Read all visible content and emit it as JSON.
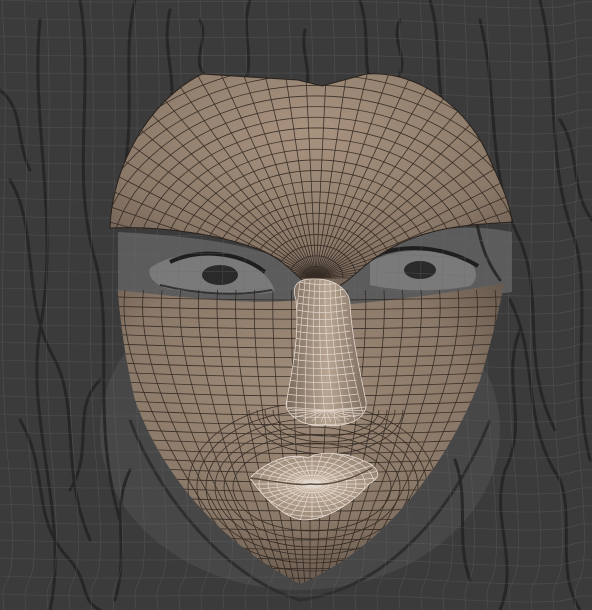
{
  "scene": {
    "description_tag": "3d-viewport",
    "colors": {
      "background": "#3b3b3b",
      "reference_sketch": "#242424",
      "reference_photo_tint": "#5a5a5a",
      "mesh_fill": "#8a7868",
      "mesh_fill_light": "#a08c7a",
      "mesh_fill_shadow": "#5e5046",
      "wire_dark": "#2a221c",
      "wire_light": "#e6dcd2",
      "back_wire": "#6a6a6a"
    },
    "layers": [
      "reference-image",
      "background-wireframe",
      "face-mesh",
      "brow-mesh",
      "nose-mesh",
      "lips-mesh"
    ]
  }
}
